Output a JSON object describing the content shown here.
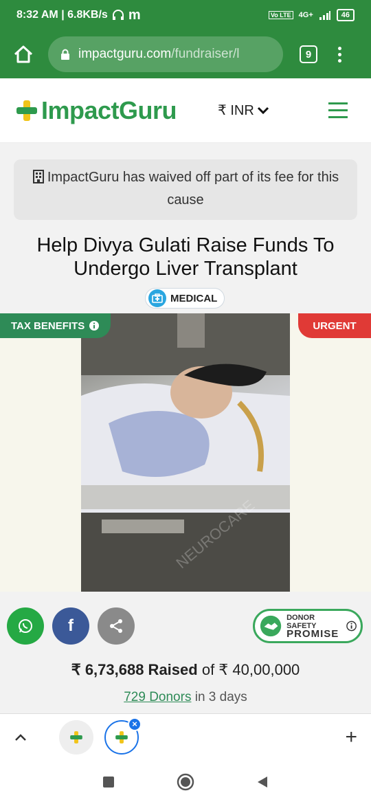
{
  "status_bar": {
    "time_speed": "8:32 AM | 6.8KB/s",
    "network": "4G+",
    "battery": "46"
  },
  "browser": {
    "url_main": "impactguru.com",
    "url_rest": "/fundraiser/l",
    "tab_count": "9"
  },
  "header": {
    "logo_text": "ImpactGuru",
    "currency": "₹ INR",
    "brand_color": "#2e9a4d"
  },
  "notice": {
    "text": "ImpactGuru has waived off part of its fee for this cause"
  },
  "fundraiser": {
    "title": "Help Divya Gulati Raise Funds To Undergo Liver Transplant",
    "category": "MEDICAL",
    "tax_tag": "TAX BENEFITS",
    "urgent_tag": "URGENT",
    "watermark": "NEUROCARE",
    "raised_amount": "₹ 6,73,688 Raised",
    "raised_of": "of ₹ 40,00,000",
    "donors_link": "729 Donors",
    "donors_suffix": "in 3 days"
  },
  "share": {
    "whatsapp_color": "#25a944",
    "facebook_color": "#3b5998",
    "share_color": "#8a8a8a",
    "facebook_label": "f"
  },
  "donor_safety": {
    "line1": "DONOR SAFETY",
    "line2": "PROMISE"
  },
  "tabs": {
    "new_tab_label": "+"
  }
}
